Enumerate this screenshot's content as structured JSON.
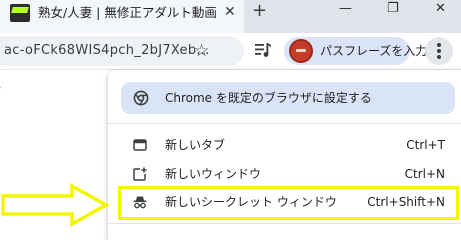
{
  "tab": {
    "title": "熟女/人妻 | 無修正アダルト動画",
    "close": "✕",
    "new_tab": "+"
  },
  "window_controls": {
    "minimize": "—",
    "restore": "❐",
    "close": "✕"
  },
  "omnibox": {
    "url": "ac-oFCk68WIS4pch_2bJ7Xeb...",
    "star": "☆"
  },
  "toolbar": {
    "passphrase_label": "パスフレーズを入力"
  },
  "menu": {
    "default_browser_label": "Chrome を既定のブラウザに設定する",
    "items": [
      {
        "label": "新しいタブ",
        "shortcut": "Ctrl+T",
        "icon": "new-tab-icon"
      },
      {
        "label": "新しいウィンドウ",
        "shortcut": "Ctrl+N",
        "icon": "new-window-icon"
      },
      {
        "label": "新しいシークレット ウィンドウ",
        "shortcut": "Ctrl+Shift+N",
        "icon": "incognito-icon"
      }
    ]
  },
  "page": {
    "chevron": "›"
  },
  "colors": {
    "tabstrip": "#dfe3ea",
    "active_tab": "#f3f6fb",
    "omnibox": "#eef1f6",
    "accent_pill": "#d9e4f6",
    "highlight": "#f5f500"
  }
}
